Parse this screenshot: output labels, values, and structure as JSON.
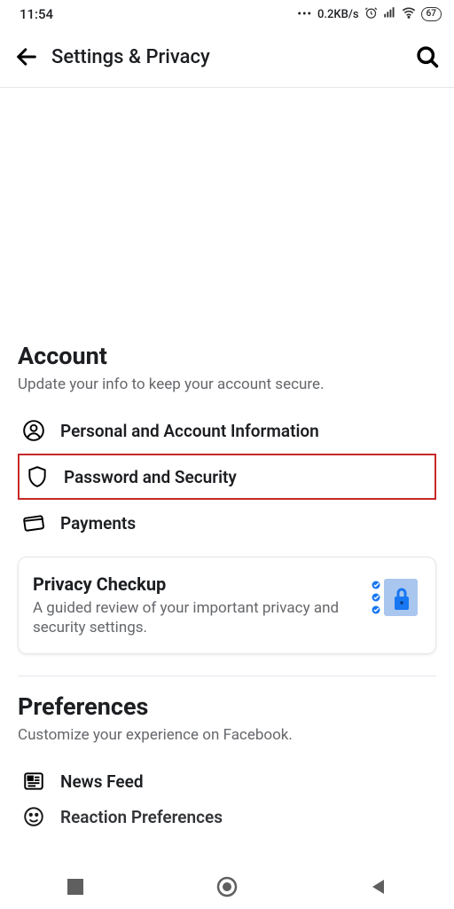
{
  "status": {
    "time": "11:54",
    "net_speed": "0.2KB/s",
    "battery": "67"
  },
  "header": {
    "title": "Settings & Privacy"
  },
  "account": {
    "title": "Account",
    "subtitle": "Update your info to keep your account secure.",
    "items": [
      {
        "label": "Personal and Account Information"
      },
      {
        "label": "Password and Security"
      },
      {
        "label": "Payments"
      }
    ]
  },
  "privacy_card": {
    "title": "Privacy Checkup",
    "subtitle": "A guided review of your important privacy and security settings."
  },
  "preferences": {
    "title": "Preferences",
    "subtitle": "Customize your experience on Facebook.",
    "items": [
      {
        "label": "News Feed"
      },
      {
        "label": "Reaction Preferences"
      }
    ]
  }
}
